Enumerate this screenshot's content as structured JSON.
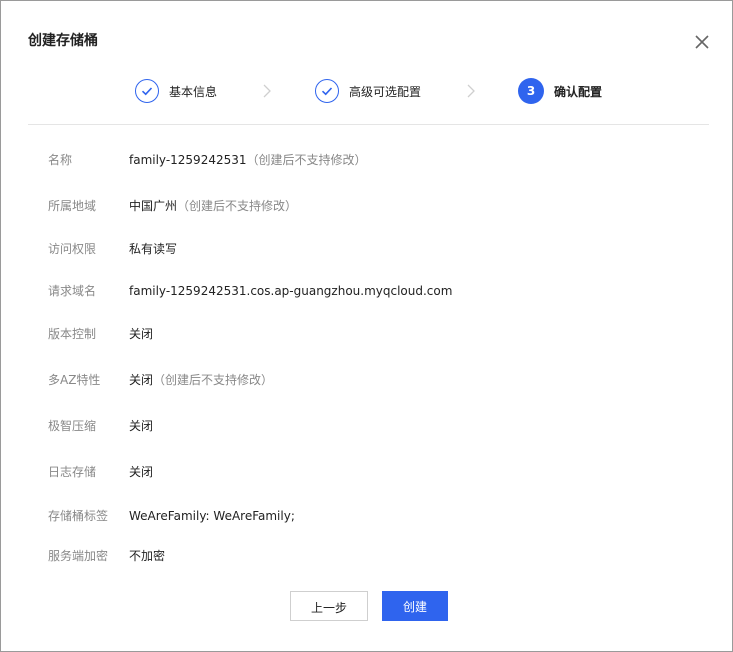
{
  "dialog": {
    "title": "创建存储桶",
    "close_icon": "close-icon"
  },
  "steps": [
    {
      "label": "基本信息",
      "state": "done",
      "icon": "check-icon"
    },
    {
      "label": "高级可选配置",
      "state": "done",
      "icon": "check-icon"
    },
    {
      "label": "确认配置",
      "state": "active",
      "number": "3"
    }
  ],
  "summary": [
    {
      "label": "名称",
      "value": "family-1259242531",
      "note": "（创建后不支持修改）"
    },
    {
      "label": "所属地域",
      "value": "中国广州",
      "note": "（创建后不支持修改）"
    },
    {
      "label": "访问权限",
      "value": "私有读写",
      "note": ""
    },
    {
      "label": "请求域名",
      "value": "family-1259242531.cos.ap-guangzhou.myqcloud.com",
      "note": ""
    },
    {
      "label": "版本控制",
      "value": "关闭",
      "note": ""
    },
    {
      "label": "多AZ特性",
      "value": "关闭",
      "note": "（创建后不支持修改）"
    },
    {
      "label": "极智压缩",
      "value": "关闭",
      "note": ""
    },
    {
      "label": "日志存储",
      "value": "关闭",
      "note": ""
    },
    {
      "label": "存储桶标签",
      "value": "WeAreFamily: WeAreFamily;",
      "note": ""
    },
    {
      "label": "服务端加密",
      "value": "不加密",
      "note": ""
    }
  ],
  "buttons": {
    "prev_label": "上一步",
    "create_label": "创建"
  },
  "colors": {
    "accent": "#2f64ee",
    "label_gray": "#888888",
    "text": "#222222"
  }
}
